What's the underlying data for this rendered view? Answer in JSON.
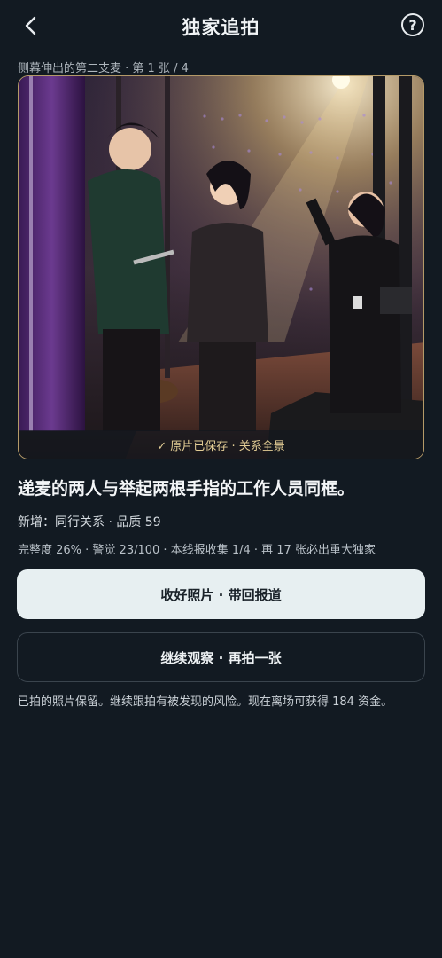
{
  "header": {
    "title": "独家追拍",
    "back_icon": "chevron-left-icon",
    "help_icon": "question-circle-icon",
    "help_glyph": "?"
  },
  "photo": {
    "caption": "侧幕伸出的第二支麦 · 第 1 张 / 4",
    "banner": "✓ 原片已保存 · 关系全景",
    "frame_color": "#b49a68",
    "banner_color": "#e3cd95"
  },
  "headline": "递麦的两人与举起两根手指的工作人员同框。",
  "meta": {
    "line1": "新增：同行关系 · 品质 59",
    "line2": "完整度 26% · 警觉 23/100 · 本线报收集 1/4 · 再 17 张必出重大独家"
  },
  "actions": {
    "primary_label": "收好照片 · 带回报道",
    "secondary_label": "继续观察 · 再拍一张"
  },
  "footnote": "已拍的照片保留。继续跟拍有被发现的风险。现在离场可获得 184 资金。"
}
